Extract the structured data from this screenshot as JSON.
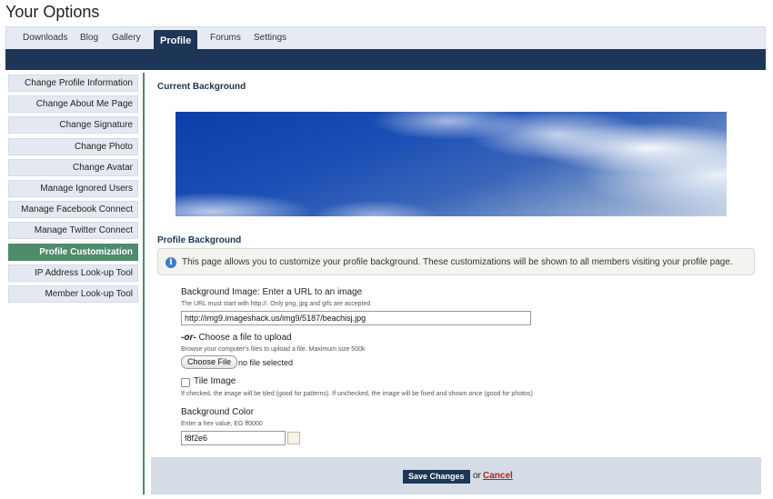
{
  "page": {
    "title": "Your Options"
  },
  "tabs": [
    {
      "label": "Downloads"
    },
    {
      "label": "Blog"
    },
    {
      "label": "Gallery"
    },
    {
      "label": "Profile",
      "active": true
    },
    {
      "label": "Forums"
    },
    {
      "label": "Settings"
    }
  ],
  "sidebar": {
    "items": [
      {
        "label": "Change Profile Information"
      },
      {
        "label": "Change About Me Page"
      },
      {
        "label": "Change Signature"
      },
      {
        "label": "Change Photo"
      },
      {
        "label": "Change Avatar"
      },
      {
        "label": "Manage Ignored Users"
      },
      {
        "label": "Manage Facebook Connect"
      },
      {
        "label": "Manage Twitter Connect"
      },
      {
        "label": "Profile Customization",
        "active": true
      },
      {
        "label": "IP Address Look-up Tool"
      },
      {
        "label": "Member Look-up Tool"
      }
    ]
  },
  "main": {
    "current_background_heading": "Current Background",
    "profile_background_heading": "Profile Background",
    "info_text": "This page allows you to customize your profile background. These customizations will be shown to all members visiting your profile page.",
    "bg_image": {
      "label": "Background Image: Enter a URL to an image",
      "hint": "The URL must start with http://. Only png, jpg and gifs are accepted",
      "value": "http://img9.imageshack.us/img9/5187/beachisj.jpg"
    },
    "file_upload": {
      "label_or": "-or-",
      "label_rest": " Choose a file to upload",
      "hint": "Browse your computer's files to upload a file. Maximum size 500k",
      "button_label": "Choose File",
      "status": "no file selected"
    },
    "tile": {
      "label": "Tile Image",
      "hint": "If checked, the image will be tiled (good for patterns). If unchecked, the image will be fixed and shown once (good for photos)",
      "checked": false
    },
    "bg_color": {
      "label": "Background Color",
      "hint": "Enter a hex value, EG ff0000",
      "value": "f8f2e6",
      "swatch_color": "#f8f2e6"
    }
  },
  "footer": {
    "save_label": "Save Changes",
    "or_text": "or",
    "cancel_label": "Cancel"
  },
  "colors": {
    "navy": "#1d3557",
    "green_accent": "#4d8b6a",
    "cancel_red": "#b22222"
  },
  "icons": {
    "info": "info-icon"
  }
}
